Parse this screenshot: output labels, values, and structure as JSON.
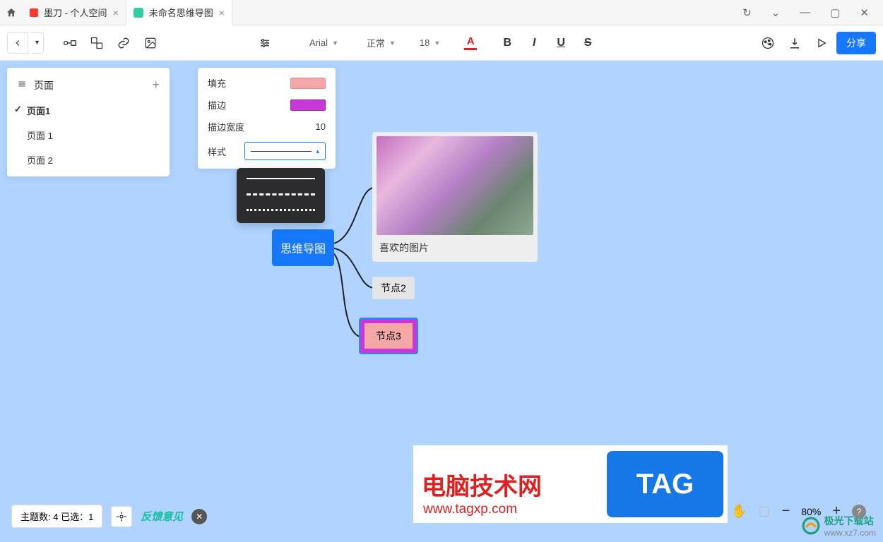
{
  "tabs": [
    {
      "label": "墨刀 - 个人空间"
    },
    {
      "label": "未命名思维导图"
    }
  ],
  "toolbar": {
    "font": "Arial",
    "weight": "正常",
    "size": "18"
  },
  "share": "分享",
  "pages": {
    "title": "页面",
    "items": [
      "页面1",
      "页面 1",
      "页面 2"
    ]
  },
  "style": {
    "fill_label": "填充",
    "stroke_label": "描边",
    "width_label": "描边宽度",
    "width_value": "10",
    "style_label": "样式"
  },
  "nodes": {
    "root": "思维导图",
    "image_caption": "喜欢的图片",
    "n2": "节点2",
    "n3": "节点3"
  },
  "logo": {
    "title": "电脑技术网",
    "url": "www.tagxp.com",
    "tag": "TAG",
    "dl_name": "极光下载站",
    "dl_url": "www.xz7.com"
  },
  "bottom": {
    "stats": "主题数: 4 已选：1",
    "feedback": "反馈意见"
  },
  "zoom": {
    "value": "80%"
  }
}
